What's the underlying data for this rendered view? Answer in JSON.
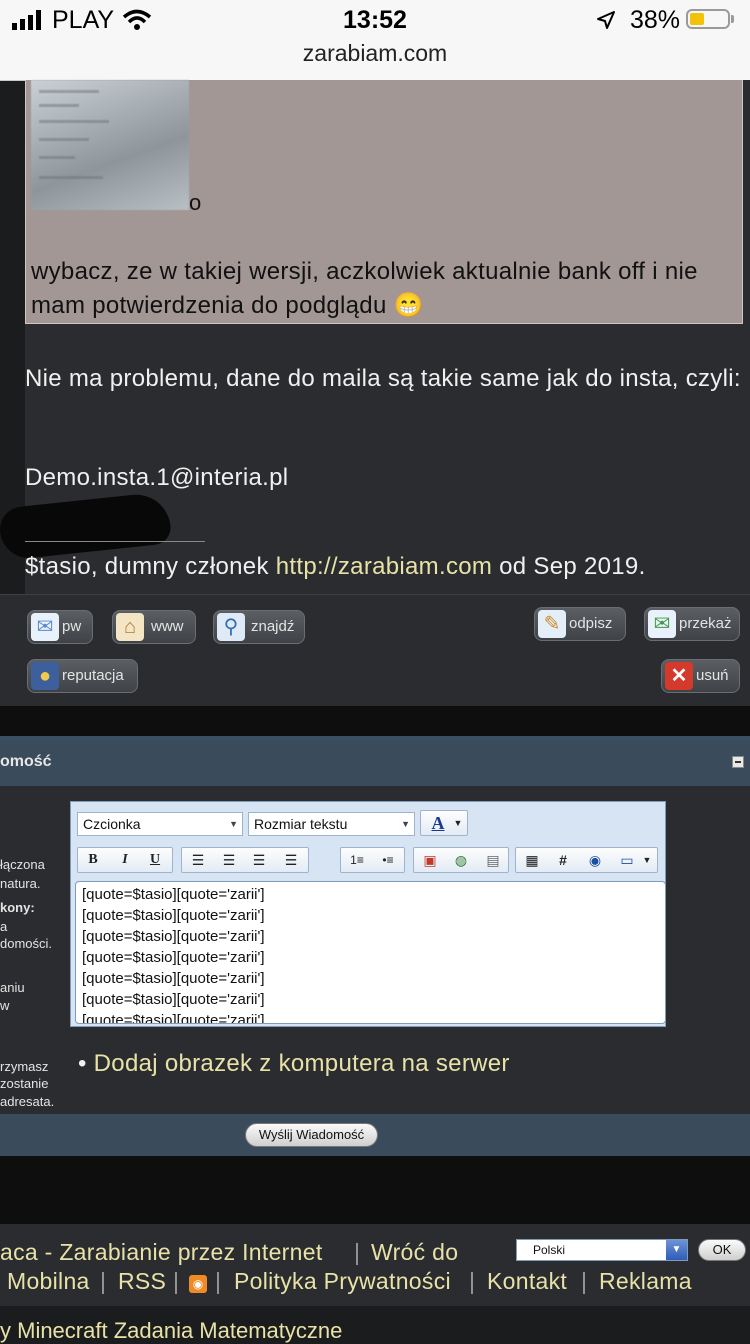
{
  "status_bar": {
    "carrier": "PLAY",
    "time": "13:52",
    "url": "zarabiam.com",
    "battery_percent": "38%",
    "battery_level": 0.38
  },
  "quote": {
    "fragment": "o",
    "text": "wybacz, ze w takiej wersji, aczkolwiek aktualnie bank off i nie mam potwierdzenia do podglądu 😁"
  },
  "post": {
    "text": "Nie ma problemu, dane do maila są takie same jak do insta, czyli:",
    "email": "Demo.insta.1@interia.pl",
    "signature_prefix": "$tasio, dumny członek ",
    "signature_link": "http://zarabiam.com",
    "signature_suffix": " od Sep 2019."
  },
  "actions": {
    "pw": "pw",
    "www": "www",
    "znajdz": "znajdź",
    "odpisz": "odpisz",
    "przekaz": "przekaż",
    "reputacja": "reputacja",
    "usun": "usuń"
  },
  "reply_panel": {
    "title": "omość",
    "side_notes": [
      "łączona",
      "natura.",
      "kony:",
      "a",
      "domości.",
      "aniu",
      "w",
      "rzymasz",
      "zostanie",
      "adresata."
    ],
    "font_select": "Czcionka",
    "size_select": "Rozmiar tekstu",
    "textarea_lines": [
      "[quote=$tasio][quote='zarii']",
      "[quote=$tasio][quote='zarii']",
      "[quote=$tasio][quote='zarii']",
      "[quote=$tasio][quote='zarii']",
      "[quote=$tasio][quote='zarii']",
      "[quote=$tasio][quote='zarii']",
      "[quote=$tasio][quote='zarii']"
    ],
    "upload_link": "Dodaj obrazek z komputera na serwer",
    "send_button": "Wyślij Wiadomość"
  },
  "footer": {
    "line1_link1": "aca - Zarabianie przez Internet",
    "line1_link2": "Wróć do",
    "line2_link1": "Mobilna",
    "line2_link2": "RSS",
    "line2_link3": "Polityka Prywatności",
    "line2_link4": "Kontakt",
    "line2_link5": "Reklama",
    "language": "Polski",
    "ok": "OK",
    "bottom_links": "y Minecraft Zadania Matematyczne"
  }
}
